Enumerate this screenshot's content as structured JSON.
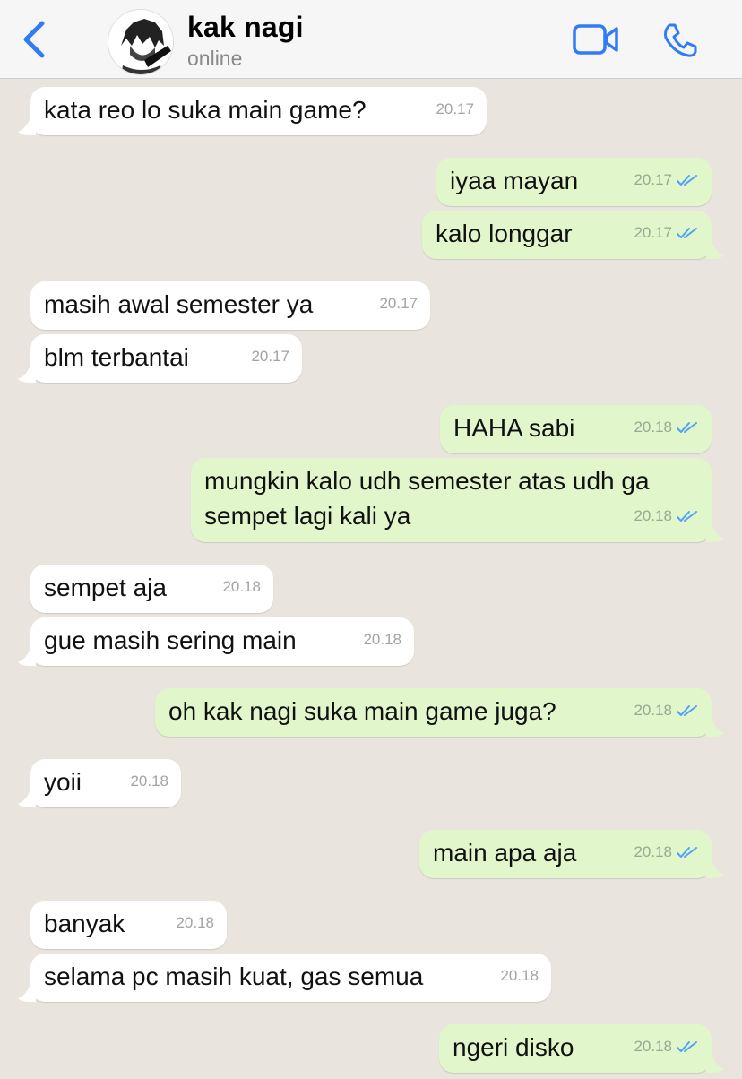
{
  "header": {
    "contact_name": "kak nagi",
    "status": "online"
  },
  "colors": {
    "accent": "#2f7cf6",
    "incoming_bubble": "#ffffff",
    "outgoing_bubble": "#e1f7cb",
    "background": "#e9e5de",
    "read_ticks": "#4fa3f7"
  },
  "icons": {
    "back": "chevron-left-icon",
    "video": "video-camera-icon",
    "call": "phone-icon",
    "read": "double-check-icon"
  },
  "messages": [
    {
      "dir": "in",
      "text": "kata reo lo suka main game?",
      "time": "20.17"
    },
    {
      "dir": "out",
      "text": "iyaa mayan",
      "time": "20.17"
    },
    {
      "dir": "out",
      "text": "kalo longgar",
      "time": "20.17"
    },
    {
      "dir": "in",
      "text": "masih awal semester ya",
      "time": "20.17"
    },
    {
      "dir": "in",
      "text": "blm terbantai",
      "time": "20.17"
    },
    {
      "dir": "out",
      "text": "HAHA sabi",
      "time": "20.18"
    },
    {
      "dir": "out",
      "text": "mungkin kalo udh semester atas udh ga sempet lagi kali ya",
      "time": "20.18"
    },
    {
      "dir": "in",
      "text": "sempet aja",
      "time": "20.18"
    },
    {
      "dir": "in",
      "text": "gue masih sering main",
      "time": "20.18"
    },
    {
      "dir": "out",
      "text": "oh kak nagi suka main game juga?",
      "time": "20.18"
    },
    {
      "dir": "in",
      "text": "yoii",
      "time": "20.18"
    },
    {
      "dir": "out",
      "text": "main apa aja",
      "time": "20.18"
    },
    {
      "dir": "in",
      "text": "banyak",
      "time": "20.18"
    },
    {
      "dir": "in",
      "text": "selama pc masih kuat, gas semua",
      "time": "20.18"
    },
    {
      "dir": "out",
      "text": "ngeri disko",
      "time": "20.18"
    }
  ]
}
